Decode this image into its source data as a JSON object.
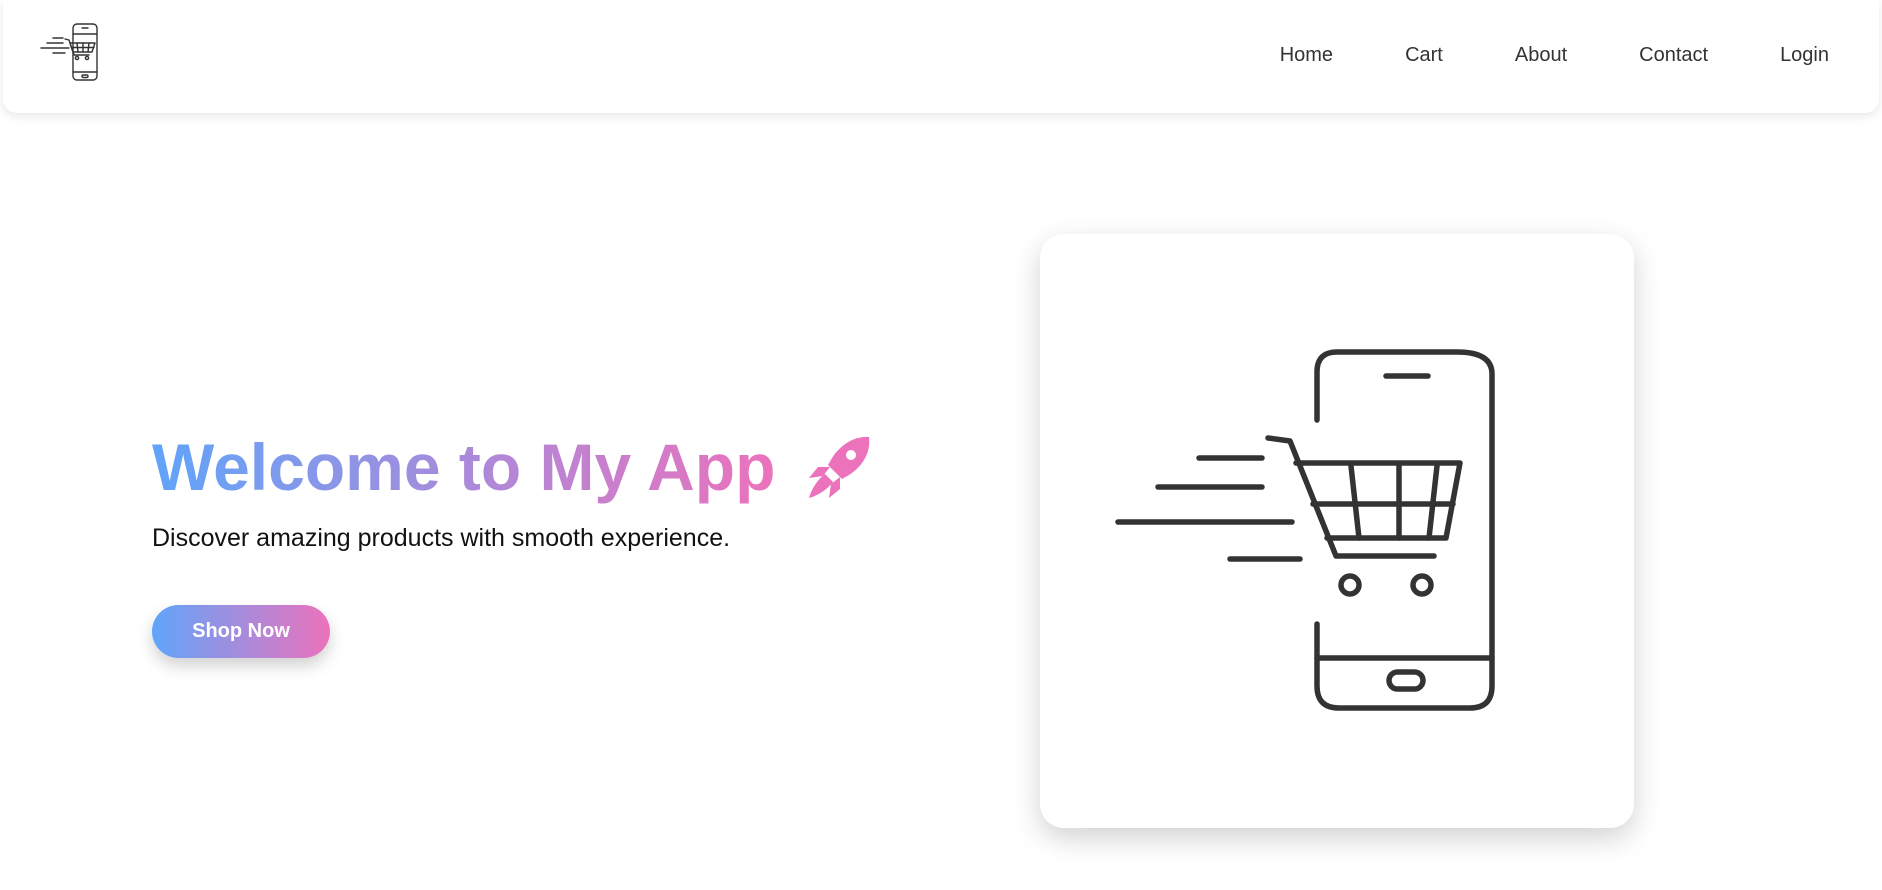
{
  "nav": {
    "logo_icon": "mobile-shopping-cart-icon",
    "links": [
      "Home",
      "Cart",
      "About",
      "Contact",
      "Login"
    ]
  },
  "hero": {
    "title": "Welcome to My App",
    "title_icon": "rocket-icon",
    "subtitle": "Discover amazing products with smooth experience.",
    "cta_label": "Shop Now",
    "illustration_icon": "mobile-shopping-cart-icon"
  },
  "colors": {
    "gradient_start": "#60a5fa",
    "gradient_mid": "#a78bdb",
    "gradient_end": "#ec72bc",
    "rocket": "#ec72bc",
    "nav_text": "#333333",
    "illustration_stroke": "#333333"
  }
}
